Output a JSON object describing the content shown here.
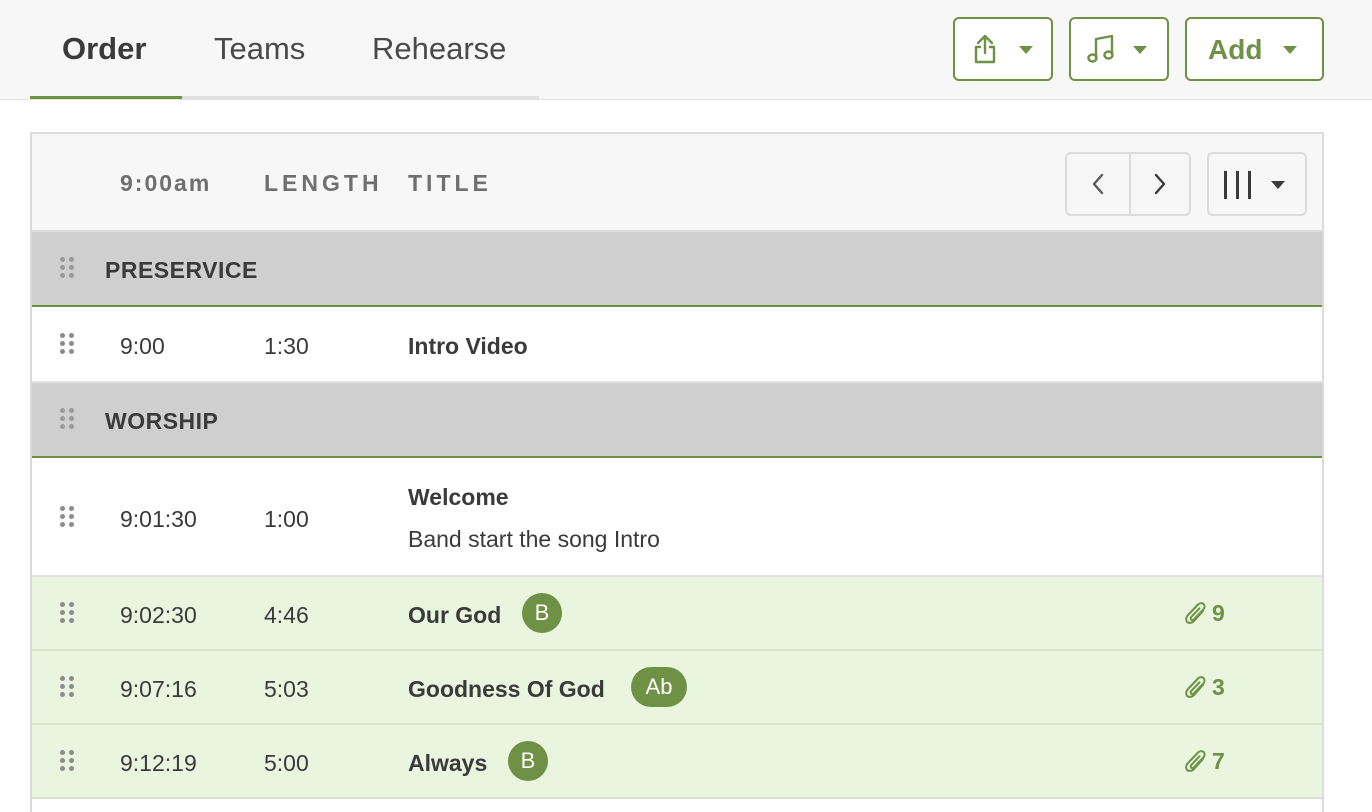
{
  "tabs": [
    {
      "label": "Order",
      "active": true
    },
    {
      "label": "Teams",
      "active": false
    },
    {
      "label": "Rehearse",
      "active": false
    }
  ],
  "toolbar": {
    "share_icon": "share-icon",
    "music_icon": "music-note-icon",
    "add_label": "Add"
  },
  "table": {
    "columns": {
      "time": "9:00am",
      "length": "LENGTH",
      "title": "TITLE"
    },
    "nav_prev_icon": "chevron-left-icon",
    "nav_next_icon": "chevron-right-icon",
    "columns_icon": "columns-icon"
  },
  "rows": [
    {
      "type": "header",
      "title": "PRESERVICE"
    },
    {
      "type": "item",
      "time": "9:00",
      "length": "1:30",
      "title": "Intro Video"
    },
    {
      "type": "header",
      "title": "WORSHIP"
    },
    {
      "type": "item",
      "time": "9:01:30",
      "length": "1:00",
      "title": "Welcome",
      "note": "Band start the song Intro"
    },
    {
      "type": "song",
      "time": "9:02:30",
      "length": "4:46",
      "title": "Our God",
      "key": "B",
      "attachments": "9"
    },
    {
      "type": "song",
      "time": "9:07:16",
      "length": "5:03",
      "title": "Goodness Of God",
      "key": "Ab",
      "attachments": "3"
    },
    {
      "type": "song",
      "time": "9:12:19",
      "length": "5:00",
      "title": "Always",
      "key": "B",
      "attachments": "7"
    }
  ],
  "colors": {
    "accent": "#6e9146",
    "section_header_bg": "#cfcfcf",
    "song_row_bg": "#eaf5df"
  }
}
